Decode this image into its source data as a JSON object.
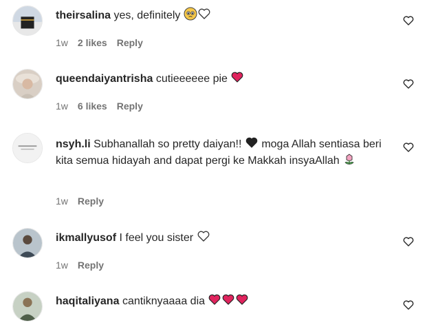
{
  "comments": [
    {
      "username": "theirsalina",
      "text": "yes, definitely",
      "time": "1w",
      "likes": "2 likes",
      "reply": "Reply",
      "emojis": [
        "pleading-face-emoji",
        "white-heart-emoji"
      ]
    },
    {
      "username": "queendaiyantrisha",
      "text": "cutieeeeee pie",
      "time": "1w",
      "likes": "6 likes",
      "reply": "Reply",
      "emojis": [
        "red-heart-emoji"
      ]
    },
    {
      "username": "nsyh.li",
      "text_part1": "Subhanallah so pretty daiyan!!",
      "text_part2": "moga Allah sentiasa beri kita semua hidayah and dapat pergi ke Makkah insyaAllah",
      "time": "1w",
      "reply": "Reply",
      "emojis": [
        "black-heart-emoji",
        "tulip-emoji"
      ]
    },
    {
      "username": "ikmallyusof",
      "text": "I feel you sister",
      "time": "1w",
      "reply": "Reply",
      "emojis": [
        "white-heart-emoji"
      ]
    },
    {
      "username": "haqitaliyana",
      "text": "cantiknyaaaa dia",
      "emojis": [
        "red-heart-emoji",
        "red-heart-emoji",
        "red-heart-emoji"
      ]
    }
  ],
  "colors": {
    "text": "#262626",
    "secondary": "#737373",
    "heart_red": "#e0245e"
  }
}
